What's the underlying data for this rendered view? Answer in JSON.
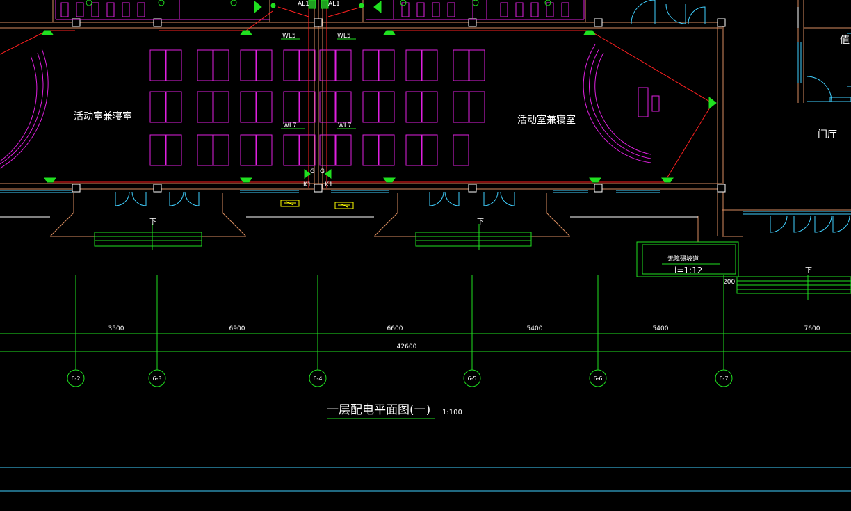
{
  "drawing": {
    "title": "一层配电平面图(一)",
    "scale": "1:100"
  },
  "rooms": {
    "left_room": "活动室兼寝室",
    "right_room": "活动室兼寝室",
    "lobby": "门厅",
    "duty_room_partial": "值"
  },
  "circuits": {
    "al1_left": "AL1",
    "al1_right": "AL1",
    "wl5_left": "WL5",
    "wl5_right": "WL5",
    "wl7_left": "WL7",
    "wl7_right": "WL7",
    "k1_left": "K1",
    "k1_right": "K1",
    "g_left": "G",
    "g_right": "G"
  },
  "ramp": {
    "label": "无障碍坡道",
    "slope": "i=1:12",
    "offset": "200"
  },
  "stairs": {
    "down_1": "下",
    "down_2": "下",
    "down_3": "下"
  },
  "dimensions": {
    "spans": [
      "3500",
      "6900",
      "6600",
      "5400",
      "5400",
      "7600"
    ],
    "total": "42600"
  },
  "axes": [
    "6-2",
    "6-3",
    "6-4",
    "6-5",
    "6-6",
    "6-7"
  ],
  "colors": {
    "background": "#000000",
    "wall": "#d98c5f",
    "furniture": "#e020e0",
    "dimension": "#00e000",
    "circuit": "#ff2020",
    "fixture": "#20e020",
    "window": "#40d0ff",
    "white": "#ffffff",
    "yellow": "#ffff00"
  }
}
